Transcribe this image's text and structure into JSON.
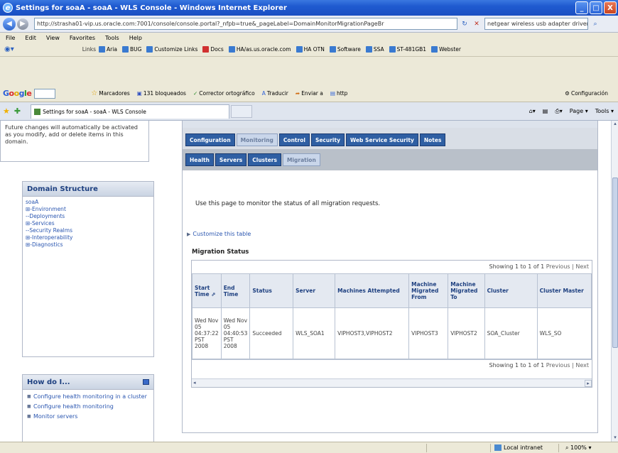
{
  "window": {
    "title": "Settings for soaA - soaA - WLS Console - Windows Internet Explorer",
    "min_glyph": "_",
    "max_glyph": "□",
    "close_glyph": "X"
  },
  "address_bar": {
    "url": "http://strasha01-vip.us.oracle.com:7001/console/console.portal?_nfpb=true&_pageLabel=DomainMonitorMigrationPageBr",
    "search_text": "netgear wireless usb adapter driver"
  },
  "menu": [
    "File",
    "Edit",
    "View",
    "Favorites",
    "Tools",
    "Help"
  ],
  "links_bar": {
    "label": "Links",
    "items": [
      {
        "label": "Aria"
      },
      {
        "label": "BUG"
      },
      {
        "label": "Customize Links"
      },
      {
        "label": "Docs"
      },
      {
        "label": "HA/as.us.oracle.com"
      },
      {
        "label": "HA OTN"
      },
      {
        "label": "Software"
      },
      {
        "label": "SSA"
      },
      {
        "label": "ST-481GB1"
      },
      {
        "label": "Webster"
      }
    ]
  },
  "google_toolbar": {
    "items": [
      "Marcadores",
      "131 bloqueados",
      "Corrector ortográfico",
      "Traducir",
      "Enviar a",
      "http"
    ],
    "config": "Configuración"
  },
  "tabs_bar": {
    "active_tab": "Settings for soaA - soaA - WLS Console",
    "tools": [
      "Page",
      "Tools"
    ]
  },
  "left_panel": {
    "change_text": "Future changes will automatically be activated as you modify, add or delete items in this domain.",
    "domain_structure": {
      "title": "Domain Structure",
      "root": "soaA",
      "items": [
        "⊞-Environment",
        "--Deployments",
        "⊞-Services",
        "--Security Realms",
        "⊞-Interoperability",
        "⊞-Diagnostics"
      ]
    },
    "how_do_i": {
      "title": "How do I...",
      "items": [
        "Configure health monitoring in a cluster",
        "Configure health monitoring",
        "Monitor servers"
      ]
    }
  },
  "main": {
    "top_tabs": [
      {
        "label": "Configuration",
        "selected": false
      },
      {
        "label": "Monitoring",
        "selected": true
      },
      {
        "label": "Control",
        "selected": false
      },
      {
        "label": "Security",
        "selected": false
      },
      {
        "label": "Web Service Security",
        "selected": false
      },
      {
        "label": "Notes",
        "selected": false
      }
    ],
    "sub_tabs": [
      {
        "label": "Health",
        "selected": false
      },
      {
        "label": "Servers",
        "selected": false
      },
      {
        "label": "Clusters",
        "selected": false
      },
      {
        "label": "Migration",
        "selected": true
      }
    ],
    "description": "Use this page to monitor the status of all migration requests.",
    "customize_link": "Customize this table",
    "section_title": "Migration Status",
    "pagination_top": {
      "showing": "Showing 1 to 1 of 1",
      "previous": "Previous",
      "sep": "|",
      "next": "Next"
    },
    "pagination_bottom": {
      "showing": "Showing 1 to 1 of 1",
      "previous": "Previous",
      "sep": "|",
      "next": "Next"
    },
    "table": {
      "columns": [
        "Start Time ⇗",
        "End Time",
        "Status",
        "Server",
        "Machines Attempted",
        "Machine Migrated From",
        "Machine Migrated To",
        "Cluster",
        "Cluster Master"
      ],
      "rows": [
        [
          "Wed Nov 05 04:37:22 PST 2008",
          "Wed Nov 05 04:40:53 PST 2008",
          "Succeeded",
          "WLS_SOA1",
          "VIPHOST3,VIPHOST2",
          "VIPHOST3",
          "VIPHOST2",
          "SOA_Cluster",
          "WLS_SO"
        ]
      ]
    }
  },
  "status_bar": {
    "zone": "Local intranet",
    "zoom": "100%"
  }
}
